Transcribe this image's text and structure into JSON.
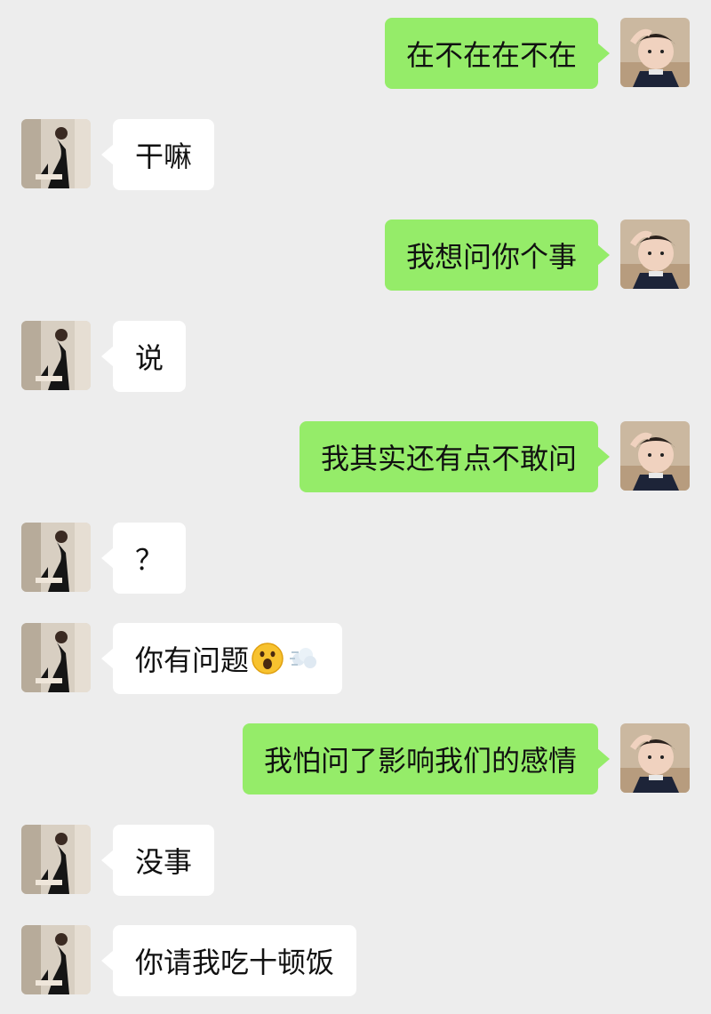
{
  "conversation": {
    "messages": [
      {
        "from": "me",
        "text": "在不在在不在"
      },
      {
        "from": "them",
        "text": "干嘛"
      },
      {
        "from": "me",
        "text": "我想问你个事"
      },
      {
        "from": "them",
        "text": "说"
      },
      {
        "from": "me",
        "text": "我其实还有点不敢问"
      },
      {
        "from": "them",
        "text": "？"
      },
      {
        "from": "them",
        "text": "你有问题",
        "emojis": [
          "astonished-face-emoji",
          "dash-away-emoji"
        ]
      },
      {
        "from": "me",
        "text": "我怕问了影响我们的感情"
      },
      {
        "from": "them",
        "text": "没事"
      },
      {
        "from": "them",
        "text": "你请我吃十顿饭"
      }
    ]
  },
  "colors": {
    "background": "#ededed",
    "my_bubble": "#95ec69",
    "their_bubble": "#ffffff",
    "text": "#111111"
  }
}
